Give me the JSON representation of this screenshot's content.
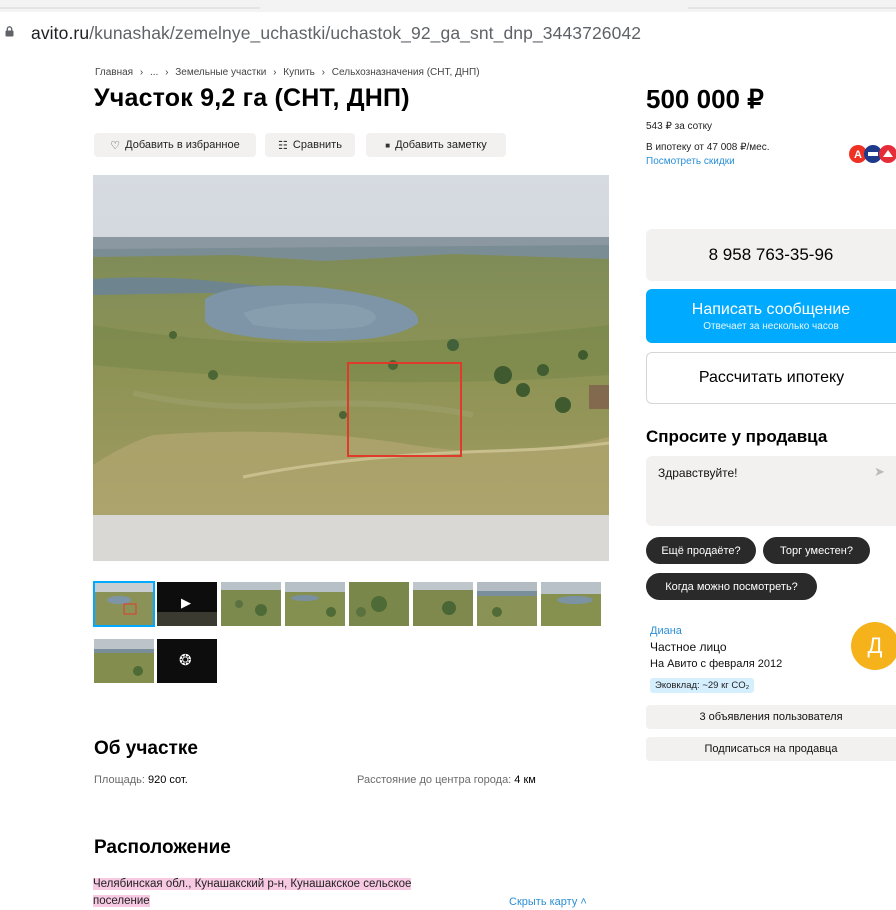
{
  "browser": {
    "url_host": "avito.ru",
    "url_path": "/kunashak/zemelnye_uchastki/uchastok_92_ga_snt_dnp_3443726042"
  },
  "breadcrumb": [
    "Главная",
    "›",
    "...",
    "›",
    "Земельные участки",
    "›",
    "Купить",
    "›",
    "Сельхозназначения (СНТ, ДНП)"
  ],
  "title": "Участок 9,2 га (СНТ, ДНП)",
  "actions": {
    "favorite": "Добавить в избранное",
    "compare": "Сравнить",
    "note": "Добавить заметку"
  },
  "icons": {
    "favorite": "♡",
    "compare": "☷",
    "note": "■",
    "play": "▶",
    "more_photos": "❂"
  },
  "gallery": {
    "photo_count": 10,
    "selected_index": 0,
    "video_thumb_index": 1
  },
  "about": {
    "heading": "Об участке",
    "area_label": "Площадь: ",
    "area_value": "920 сот.",
    "distance_label": "Расстояние до центра города: ",
    "distance_value": "4 км"
  },
  "location": {
    "heading": "Расположение",
    "address_line1": "Челябинская обл., Кунашакский р-н, Кунашакское сельское",
    "address_line2": "поселение",
    "hide_map": "Скрыть карту ˄"
  },
  "price": {
    "value": "500 000 ₽",
    "per_sotka": "543 ₽ за сотку",
    "mortgage": "В ипотеку от 47 008 ₽/мес.",
    "discounts_link": "Посмотреть скидки"
  },
  "contact": {
    "phone": "8 958 763-35-96",
    "message_title": "Написать сообщение",
    "message_sub": "Отвечает за несколько часов",
    "calc_mortgage": "Рассчитать ипотеку"
  },
  "ask_seller": {
    "heading": "Спросите у продавца",
    "message": "Здравствуйте!",
    "send_icon": "➤",
    "quick_questions": [
      "Ещё продаёте?",
      "Торг уместен?",
      "Когда можно посмотреть?"
    ]
  },
  "seller": {
    "name": "Диана",
    "type": "Частное лицо",
    "since": "На Авито с февраля 2012",
    "eco": "Эковклад: ~29 кг CO₂",
    "avatar_letter": "Д",
    "listings": "3 объявления пользователя",
    "subscribe": "Подписаться на продавца"
  },
  "colors": {
    "accent_blue": "#00aaff",
    "link_blue": "#2b8fd6",
    "avatar_yellow": "#f5b21b",
    "highlight_pink": "#f7c9e3",
    "plot_outline_red": "#e03a2b"
  }
}
